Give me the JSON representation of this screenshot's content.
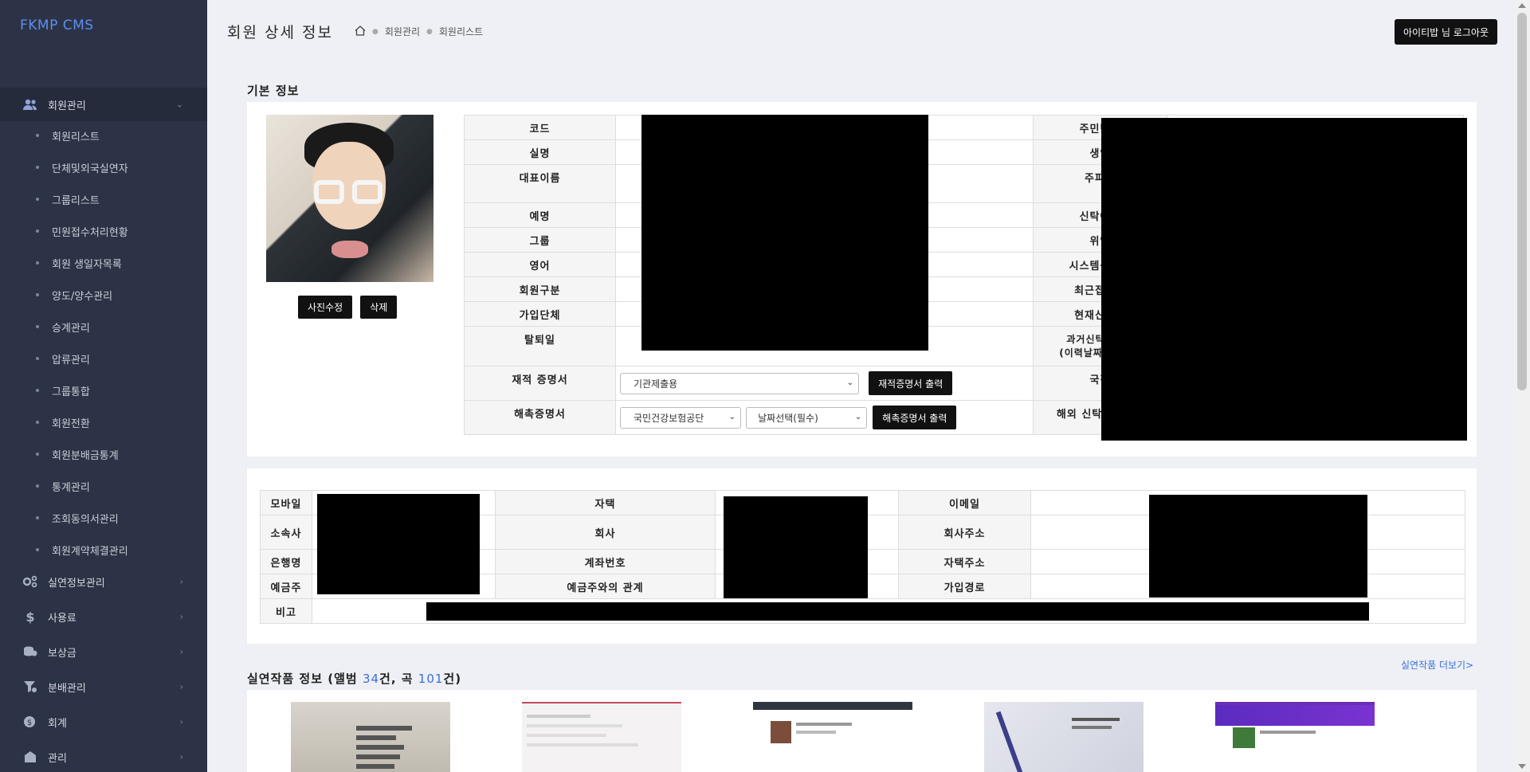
{
  "app": {
    "brand": "FKMP CMS"
  },
  "header": {
    "title": "회원 상세 정보",
    "breadcrumb": [
      "회원관리",
      "회원리스트"
    ],
    "logout_label": "아이티밥  님 로그아웃"
  },
  "sidebar": {
    "active_group": {
      "label": "회원관리",
      "icon": "users-icon"
    },
    "subitems": [
      "회원리스트",
      "단체및외국실연자",
      "그룹리스트",
      "민원접수처리현황",
      "회원 생일자목록",
      "양도/양수관리",
      "승계관리",
      "압류관리",
      "그룹통합",
      "회원전환",
      "회원분배금통계",
      "통계관리",
      "조회동의서관리",
      "회원계약체결관리"
    ],
    "groups": [
      {
        "label": "실연정보관리",
        "icon": "gears-icon"
      },
      {
        "label": "사용료",
        "icon": "dollar-icon"
      },
      {
        "label": "보상금",
        "icon": "coins-icon"
      },
      {
        "label": "분배관리",
        "icon": "filter-icon"
      },
      {
        "label": "회계",
        "icon": "money-icon"
      },
      {
        "label": "관리",
        "icon": "building-icon"
      }
    ]
  },
  "basic": {
    "section_title": "기본 정보",
    "photo_edit": "사진수정",
    "photo_delete": "삭제",
    "left_labels": [
      "코드",
      "실명",
      "대표이름",
      "예명",
      "그룹",
      "영어",
      "회원구분",
      "가입단체",
      "탈퇴일",
      "재적 증명서",
      "해촉증명서"
    ],
    "right_labels": [
      "주민번호",
      "생일",
      "주파트",
      "신탁여부",
      "위임",
      "시스템등록일",
      "최근접속일",
      "현재신탁일",
      "과거신탁일이력",
      "(이력날짜) 신탁일",
      "국적",
      "해외 신탁제외여부"
    ],
    "cert_select": "기관제출용",
    "cert_button": "재적증명서 출력",
    "dismiss_select1": "국민건강보험공단",
    "dismiss_select2": "날짜선택(필수)",
    "dismiss_button": "해촉증명서 출력"
  },
  "contact": {
    "labels": [
      "모바일",
      "자택",
      "이메일",
      "소속사",
      "회사",
      "회사주소",
      "은행명",
      "계좌번호",
      "자택주소",
      "예금주",
      "예금주와의 관계",
      "가입경로",
      "비고"
    ]
  },
  "works": {
    "title_prefix": "실연작품 정보 (앨범 ",
    "album_count": "34",
    "title_mid": "건, 곡 ",
    "song_count": "101",
    "title_suffix": "건)",
    "more_label": "실연작품 더보기>",
    "count_color": "#3a6fd8"
  }
}
